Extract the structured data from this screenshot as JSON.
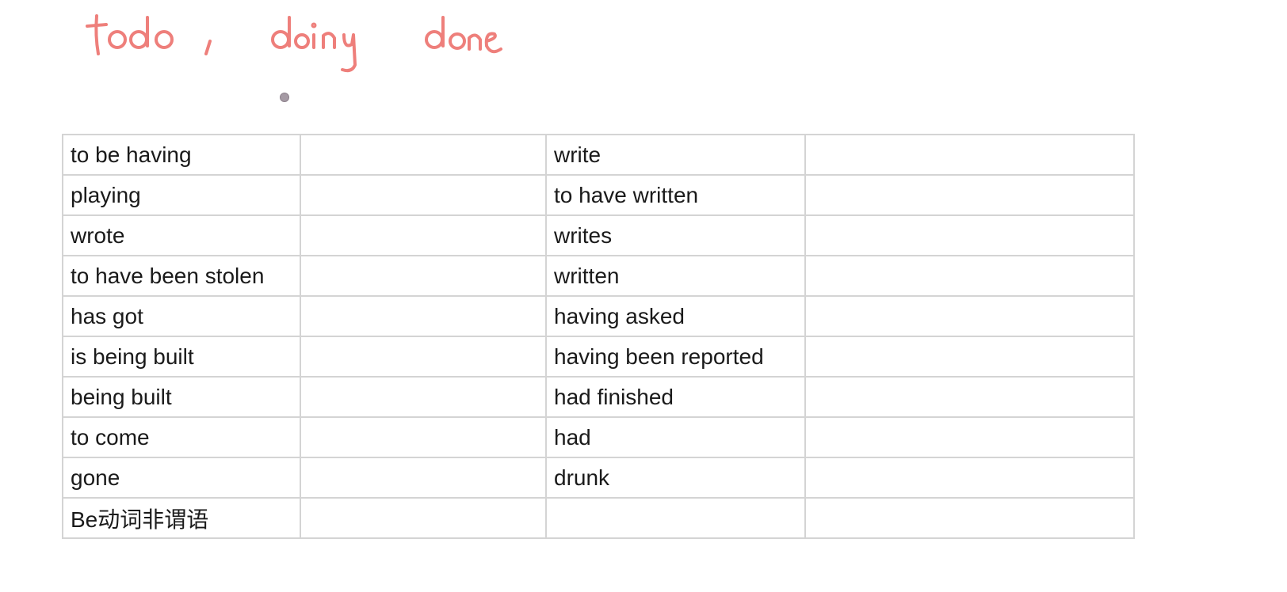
{
  "handwritten_note": "to do , doing done",
  "table": {
    "rows": [
      {
        "left": "to be having",
        "left_answer": "",
        "right": "write",
        "right_answer": ""
      },
      {
        "left": "playing",
        "left_answer": "",
        "right": "to have written",
        "right_answer": ""
      },
      {
        "left": "wrote",
        "left_answer": "",
        "right": "writes",
        "right_answer": ""
      },
      {
        "left": "to have been stolen",
        "left_answer": "",
        "right": "written",
        "right_answer": ""
      },
      {
        "left": "has got",
        "left_answer": "",
        "right": "having asked",
        "right_answer": ""
      },
      {
        "left": "is being built",
        "left_answer": "",
        "right": "having been reported",
        "right_answer": ""
      },
      {
        "left": "being built",
        "left_answer": "",
        "right": "had finished",
        "right_answer": ""
      },
      {
        "left": "to come",
        "left_answer": "",
        "right": "had",
        "right_answer": ""
      },
      {
        "left": "gone",
        "left_answer": "",
        "right": "drunk",
        "right_answer": ""
      },
      {
        "left": "Be动词非谓语",
        "left_answer": "",
        "right": "",
        "right_answer": ""
      }
    ]
  },
  "colors": {
    "ink": "#ee7f7b",
    "border": "#d4d4d4",
    "text": "#1a1a1a"
  }
}
